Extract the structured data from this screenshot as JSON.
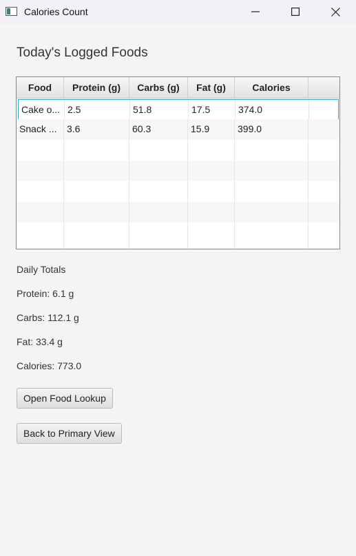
{
  "window": {
    "title": "Calories Count",
    "controls": [
      "minimize-icon",
      "maximize-icon",
      "close-icon"
    ]
  },
  "heading": "Today's Logged Foods",
  "table": {
    "columns": [
      "Food",
      "Protein (g)",
      "Carbs (g)",
      "Fat (g)",
      "Calories",
      ""
    ],
    "rows": [
      [
        "Cake o...",
        "2.5",
        "51.8",
        "17.5",
        "374.0",
        ""
      ],
      [
        "Snack ...",
        "3.6",
        "60.3",
        "15.9",
        "399.0",
        ""
      ]
    ],
    "selected_row": 0,
    "accent": "#2fa8d0"
  },
  "totals": {
    "title": "Daily Totals",
    "protein": "Protein: 6.1 g",
    "carbs": "Carbs: 112.1 g",
    "fat": "Fat: 33.4 g",
    "calories": "Calories: 773.0"
  },
  "buttons": {
    "lookup": "Open Food Lookup",
    "back": "Back to Primary View"
  }
}
